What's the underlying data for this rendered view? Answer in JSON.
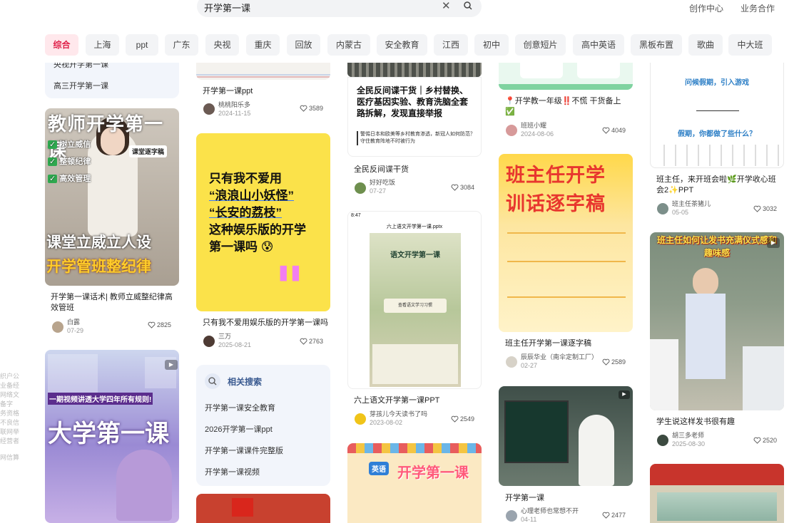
{
  "search": {
    "value": "开学第一课"
  },
  "header_links": [
    "创作中心",
    "业务合作"
  ],
  "tags": [
    "综合",
    "上海",
    "ppt",
    "广东",
    "央视",
    "重庆",
    "回放",
    "内蒙古",
    "安全教育",
    "江西",
    "初中",
    "创意短片",
    "高中英语",
    "黑板布置",
    "歌曲",
    "中大班"
  ],
  "col1": {
    "top_items": [
      "央视开学第一课",
      "高三开学第一课"
    ],
    "card1": {
      "title": "开学第一课话术| 教师立威整纪律高效管班",
      "author": "白露",
      "date": "07-29",
      "likes": "2825",
      "img_title": "教师开学第一课",
      "img_bottom": "课堂立威立人设",
      "img_bottom2": "开学管班整纪律",
      "img_checks": [
        "树立威信",
        "整顿纪律",
        "高效管理"
      ],
      "img_badge": "课堂逐字稿"
    },
    "card2": {
      "img_title": "大学第一课",
      "img_sub": "一期视频讲透大学四年所有规则!"
    }
  },
  "col2": {
    "card1": {
      "title": "开学第一课ppt",
      "author": "桃桃阳乐多",
      "date": "2024-11-15",
      "likes": "3589"
    },
    "card2": {
      "title": "只有我不爱用娱乐版的开学第一课吗",
      "author": "三万",
      "date": "2025-08-21",
      "likes": "2763",
      "img_text": [
        "只有我不爱用",
        "“浪浪山小妖怪”",
        "“长安的荔枝”",
        "这种娱乐版的开学",
        "第一课吗"
      ]
    },
    "related": {
      "heading": "相关搜索",
      "items": [
        "开学第一课安全教育",
        "2026开学第一课ppt",
        "开学第一课课件完整版",
        "开学第一课视频"
      ]
    }
  },
  "col3": {
    "card1": {
      "title": "全民反间谍干货",
      "author": "好好吃饭",
      "date": "07-27",
      "likes": "3084",
      "img_text": "全民反间谍干货｜乡村替换、医疗基因实验、教育洗脑全套路拆解，发现直接举报",
      "img_small": "警惕日本和欧美等乡村教育渗透，新冠人如何防范？守住教育阵地不时被行为"
    },
    "card2": {
      "title": "六上语文开学第一课PPT",
      "author": "芽孩儿今天读书了吗",
      "date": "2023-08-02",
      "likes": "2549",
      "img_header": "六上语文开学第一课.pptx",
      "img_title": "语文开学第一课",
      "img_button": "查看语文学习习惯"
    },
    "card3": {
      "img_title": "开学第一课",
      "img_badge": "英语"
    }
  },
  "col4": {
    "card1": {
      "title": "开学教一年级‼️不慌 干货备上✅",
      "author": "班班小耀",
      "date": "2024-08-06",
      "likes": "4049"
    },
    "card2": {
      "title": "班主任开学第一课逐字稿",
      "author": "辰辰华业（南伞定制工厂）",
      "date": "02-27",
      "likes": "2589",
      "img_title1": "班主任开学",
      "img_title2": "训话逐字稿"
    },
    "card3": {
      "title": "开学第一课",
      "author": "心理老师也常想不开",
      "date": "04-11",
      "likes": "2477"
    }
  },
  "col5": {
    "card1": {
      "title": "班主任，来开班会啦🌿开学收心班会2✨PPT",
      "author": "班主任茶猪儿",
      "date": "05-05",
      "likes": "3032",
      "img_text1": "问候假期，引入游戏",
      "img_text2": "假期，你都做了些什么？"
    },
    "card2": {
      "title": "学生说这样发书很有趣",
      "author": "胡三多老师",
      "date": "2025-08-30",
      "likes": "2520",
      "img_title": "班主任如何让发书充满仪式感和趣味感"
    }
  },
  "colors": {
    "accent": "#e0224a",
    "tag_bg": "#f3f4f6",
    "related_bg": "#f2f5fb"
  }
}
